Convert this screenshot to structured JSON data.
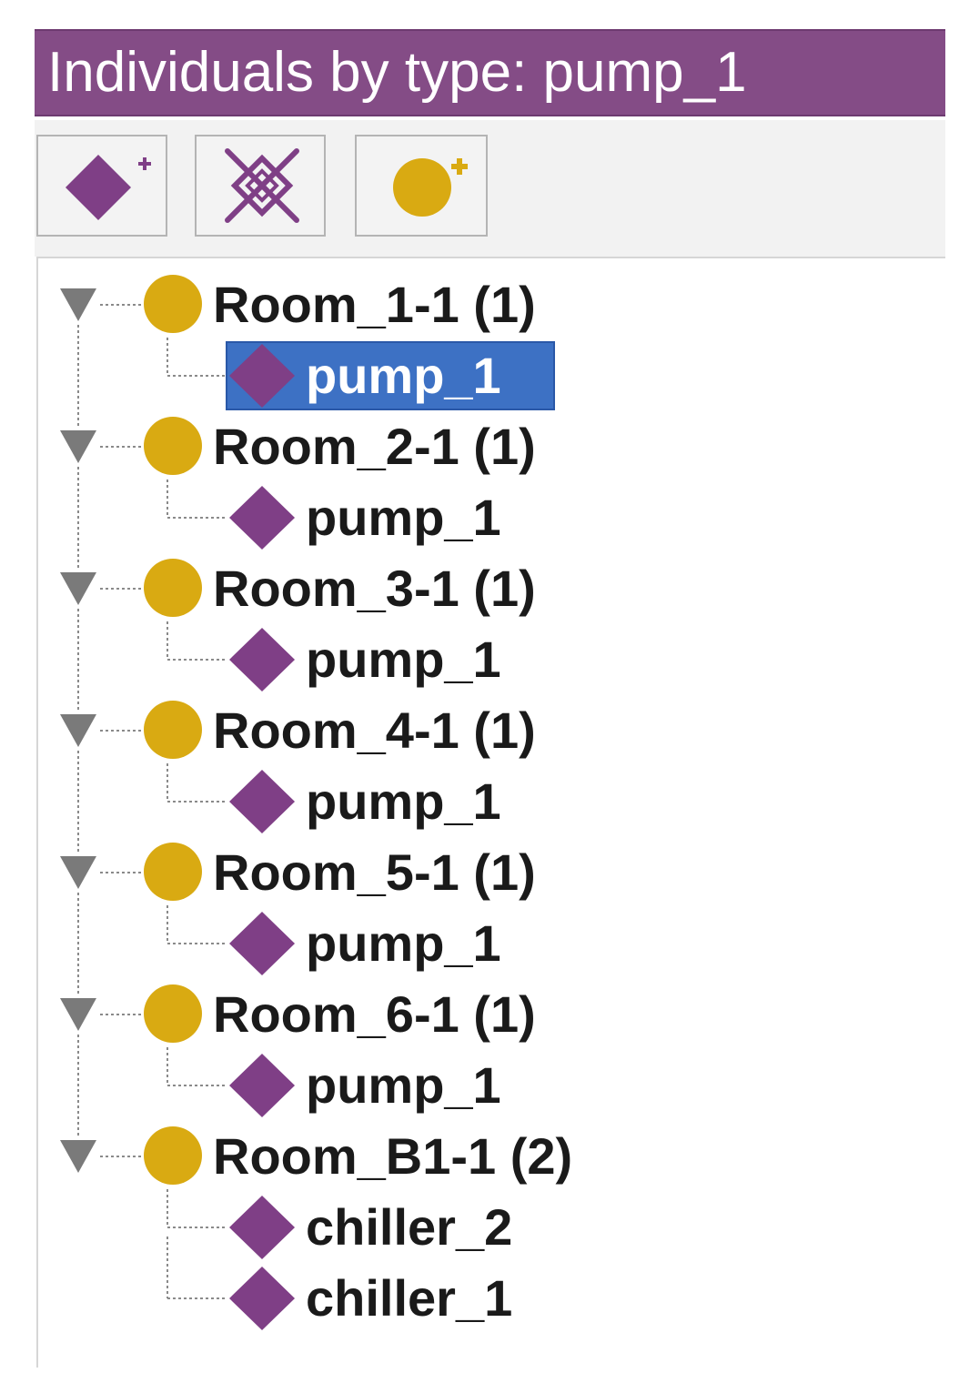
{
  "header": {
    "title": "Individuals by type: pump_1"
  },
  "toolbar": {
    "buttons": [
      {
        "name": "add-individual-button",
        "icon": "diamond-plus-icon"
      },
      {
        "name": "delete-individual-button",
        "icon": "diamond-cross-icon"
      },
      {
        "name": "add-class-button",
        "icon": "circle-plus-icon"
      }
    ]
  },
  "colors": {
    "header": "#844c86",
    "individual": "#7f3f86",
    "class": "#d9aa12",
    "selection": "#3d71c4"
  },
  "tree": [
    {
      "label": "Room_1-1 (1)",
      "children": [
        {
          "label": "pump_1",
          "selected": true
        }
      ]
    },
    {
      "label": "Room_2-1 (1)",
      "children": [
        {
          "label": "pump_1"
        }
      ]
    },
    {
      "label": "Room_3-1 (1)",
      "children": [
        {
          "label": "pump_1"
        }
      ]
    },
    {
      "label": "Room_4-1 (1)",
      "children": [
        {
          "label": "pump_1"
        }
      ]
    },
    {
      "label": "Room_5-1 (1)",
      "children": [
        {
          "label": "pump_1"
        }
      ]
    },
    {
      "label": "Room_6-1 (1)",
      "children": [
        {
          "label": "pump_1"
        }
      ]
    },
    {
      "label": "Room_B1-1 (2)",
      "children": [
        {
          "label": "chiller_2"
        },
        {
          "label": "chiller_1"
        }
      ]
    }
  ]
}
